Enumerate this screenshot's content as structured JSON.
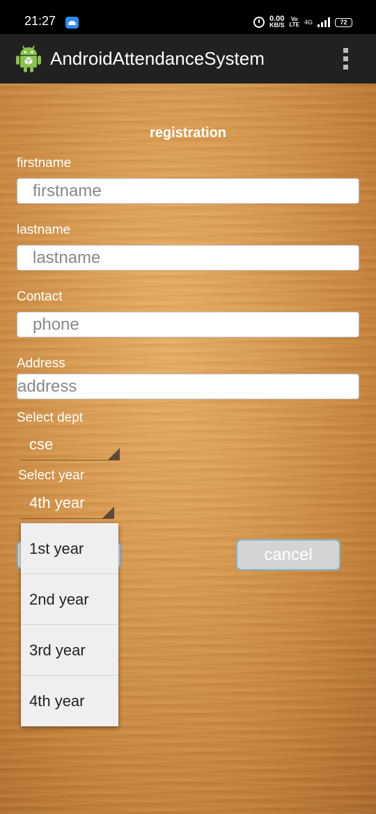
{
  "status_bar": {
    "time": "21:27",
    "speed_value": "0.00",
    "speed_unit": "KB/S",
    "volte_top": "Vo",
    "volte_bottom": "LTE",
    "network": "4G",
    "battery": "72"
  },
  "app_bar": {
    "title": "AndroidAttendanceSystem",
    "accent": "#212121"
  },
  "form": {
    "title": "registration",
    "firstname_label": "firstname",
    "firstname_placeholder": "firstname",
    "lastname_label": "lastname",
    "lastname_placeholder": "lastname",
    "contact_label": "Contact",
    "contact_placeholder": "phone",
    "address_label": "Address",
    "address_placeholder": "address",
    "dept_label": "Select dept",
    "dept_value": "cse",
    "year_label": "Select year",
    "year_value": "4th year",
    "cancel_label": "cancel"
  },
  "year_dropdown": {
    "options": [
      "1st year",
      "2nd year",
      "3rd year",
      "4th year"
    ]
  }
}
